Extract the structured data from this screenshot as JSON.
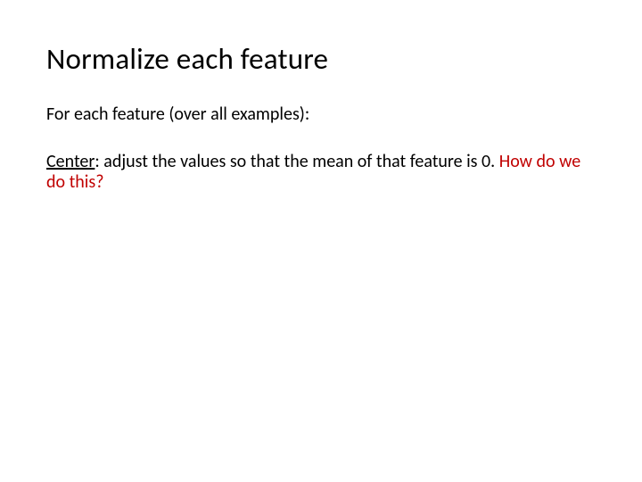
{
  "title": "Normalize each feature",
  "line1": "For each feature (over all examples):",
  "center_label": "Center",
  "center_sep": ":",
  "center_body": "  adjust the values so that the mean of that feature is 0.  ",
  "question": "How do we do this?"
}
